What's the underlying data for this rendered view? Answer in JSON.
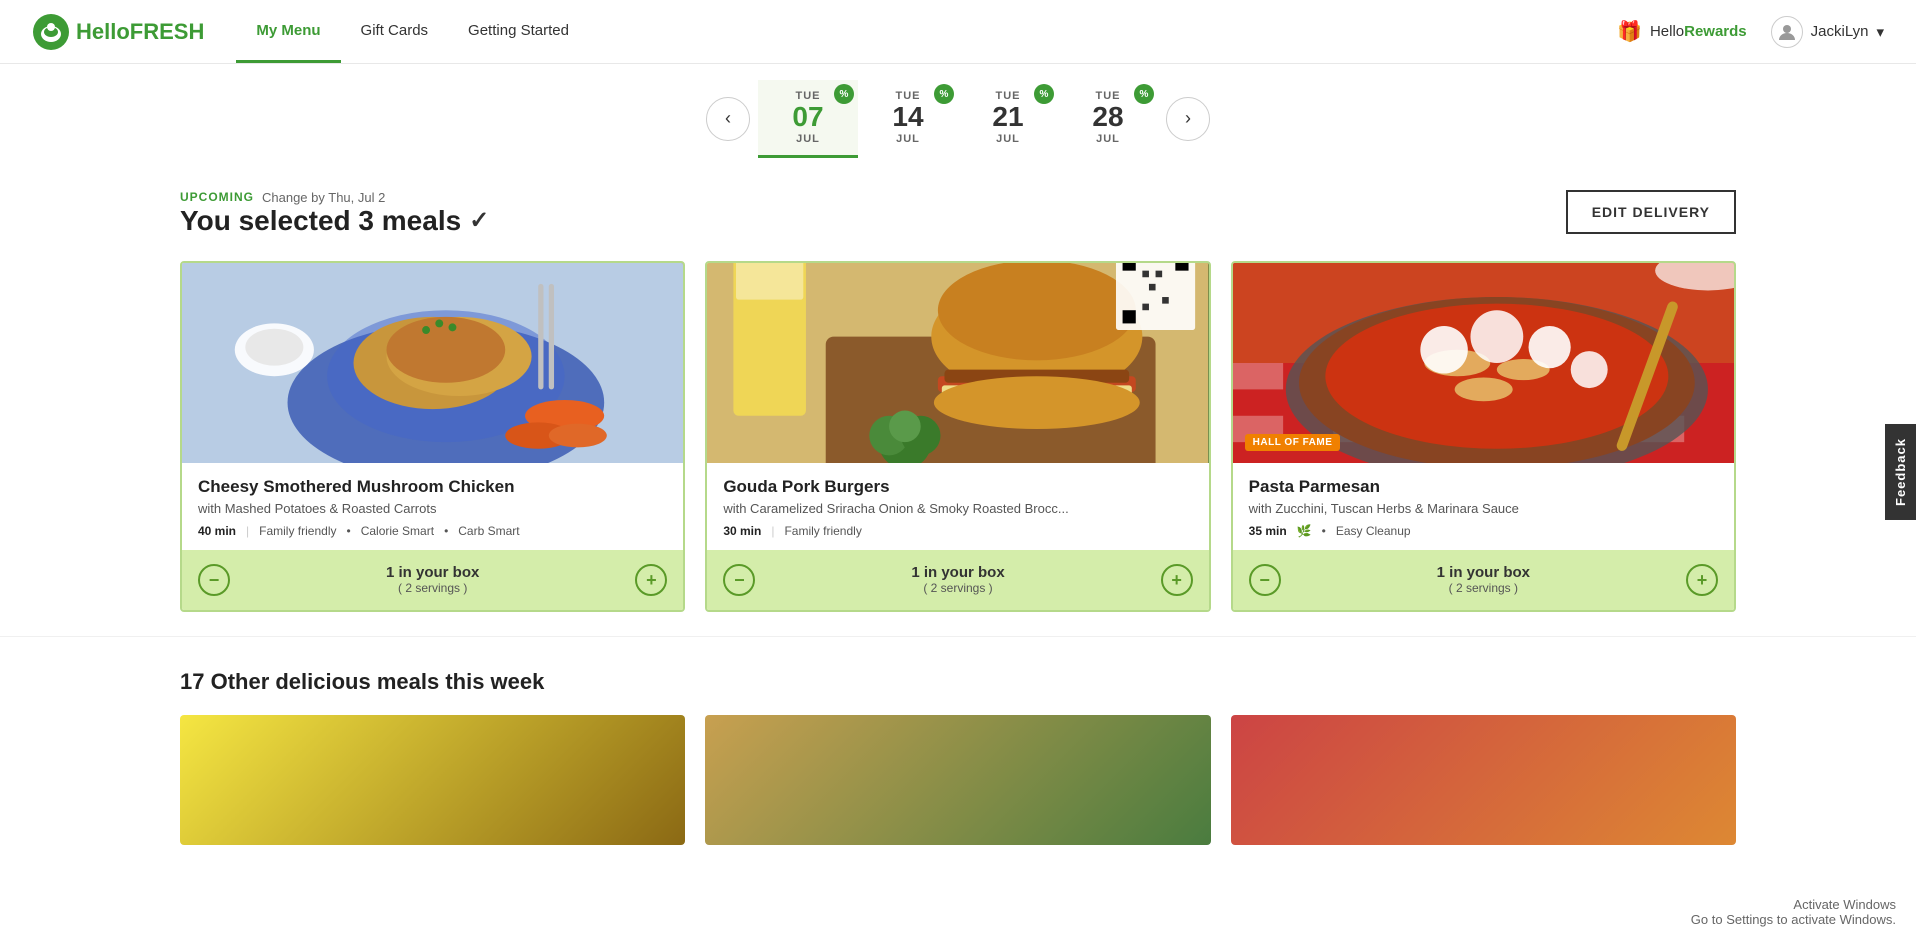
{
  "header": {
    "logo": {
      "hello": "Hello",
      "fresh": "FRESH"
    },
    "nav": [
      {
        "id": "my-menu",
        "label": "My Menu",
        "active": true
      },
      {
        "id": "gift-cards",
        "label": "Gift Cards",
        "active": false
      },
      {
        "id": "getting-started",
        "label": "Getting Started",
        "active": false
      }
    ],
    "rewards": {
      "label_prefix": "Hello",
      "label_suffix": "Rewards",
      "icon": "🎁"
    },
    "user": {
      "name": "JackiLyn",
      "chevron": "▾"
    }
  },
  "date_nav": {
    "prev_arrow": "‹",
    "next_arrow": "›",
    "dates": [
      {
        "day": "TUE",
        "num": "07",
        "month": "JUL",
        "active": true,
        "has_badge": true
      },
      {
        "day": "TUE",
        "num": "14",
        "month": "JUL",
        "active": false,
        "has_badge": true
      },
      {
        "day": "TUE",
        "num": "21",
        "month": "JUL",
        "active": false,
        "has_badge": true
      },
      {
        "day": "TUE",
        "num": "28",
        "month": "JUL",
        "active": false,
        "has_badge": true
      }
    ],
    "badge_text": "%"
  },
  "hero": {
    "upcoming_label": "UPCOMING",
    "change_by": "Change by Thu, Jul 2",
    "selected_meals_text": "You selected 3 meals",
    "checkmark": "✓",
    "edit_button": "EDIT DELIVERY"
  },
  "meals": [
    {
      "id": "meal-1",
      "title": "Cheesy Smothered Mushroom Chicken",
      "subtitle": "with Mashed Potatoes & Roasted Carrots",
      "time": "40 min",
      "tags": [
        "Family friendly",
        "Calorie Smart",
        "Carb Smart"
      ],
      "in_box": "1 in your box",
      "servings": "( 2 servings )",
      "hall_of_fame": false,
      "leaf": false,
      "img_class": "food-img-1"
    },
    {
      "id": "meal-2",
      "title": "Gouda Pork Burgers",
      "subtitle": "with Caramelized Sriracha Onion & Smoky Roasted Brocc...",
      "time": "30 min",
      "tags": [
        "Family friendly"
      ],
      "in_box": "1 in your box",
      "servings": "( 2 servings )",
      "hall_of_fame": false,
      "leaf": false,
      "img_class": "food-img-2"
    },
    {
      "id": "meal-3",
      "title": "Pasta Parmesan",
      "subtitle": "with Zucchini, Tuscan Herbs & Marinara Sauce",
      "time": "35 min",
      "tags": [
        "Easy Cleanup"
      ],
      "in_box": "1 in your box",
      "servings": "( 2 servings )",
      "hall_of_fame": true,
      "hall_of_fame_text": "HALL OF FAME",
      "leaf": true,
      "img_class": "food-img-3"
    }
  ],
  "other_meals": {
    "title": "17 Other delicious meals this week"
  },
  "feedback": {
    "label": "Feedback"
  },
  "activate_windows": {
    "line1": "Activate Windows",
    "line2": "Go to Settings to activate Windows."
  }
}
